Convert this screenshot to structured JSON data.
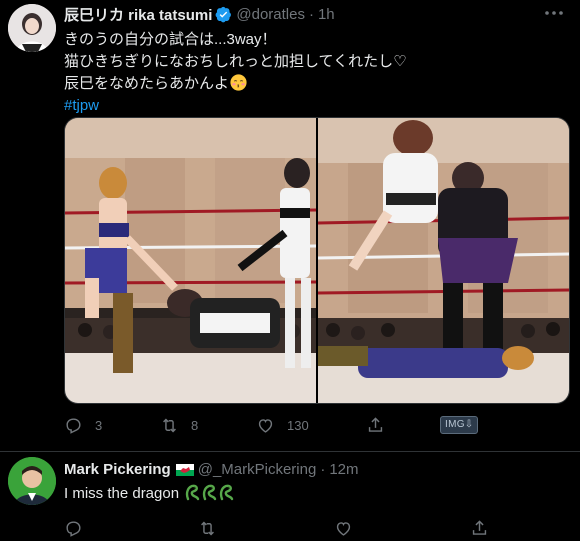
{
  "colors": {
    "background": "#000000",
    "text": "#e7e9ea",
    "muted": "#71767b",
    "link": "#1d9bf0",
    "verified": "#1d9bf0",
    "divider": "#2f3336"
  },
  "tweets": [
    {
      "author_name": "辰巳リカ rika tatsumi",
      "verified": true,
      "handle": "@doratles",
      "dot": "·",
      "time": "1h",
      "text_lines": [
        "きのうの自分の試合は...3way！",
        "猫ひきちぎりになおちしれっと加担してくれたし♡",
        "辰巳をなめたらあかんよ"
      ],
      "emoji": "kissing-face-emoji",
      "hashtag": "#tjpw",
      "photos": [
        "wrestling-photo-left",
        "wrestling-photo-right"
      ],
      "actions": {
        "reply_count": "3",
        "retweet_count": "8",
        "like_count": "130",
        "img_badge": "IMG⇩"
      }
    },
    {
      "author_name": "Mark Pickering",
      "flag": "wales-flag-emoji",
      "handle": "@_MarkPickering",
      "dot": "·",
      "time": "12m",
      "text": "I miss the dragon",
      "emoji": "dragon-emoji"
    }
  ]
}
